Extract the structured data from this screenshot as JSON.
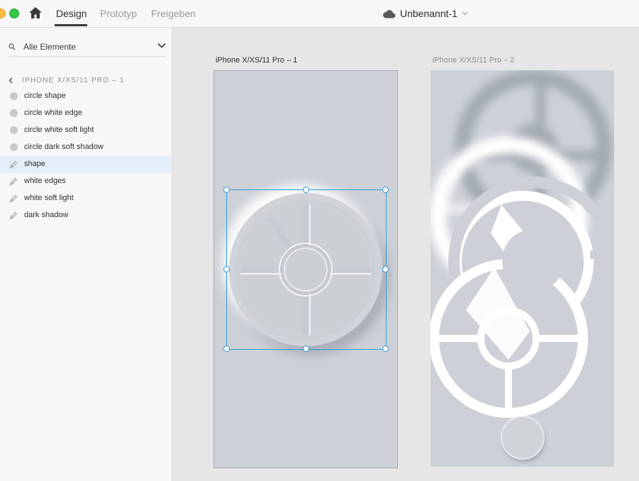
{
  "toolbar": {
    "tabs": [
      "Design",
      "Prototyp",
      "Freigeben"
    ],
    "active_tab": "Design",
    "doc_title": "Unbenannt-1",
    "icons": {
      "home": "home-icon",
      "cloud": "cloud-icon",
      "title_chevron": "chevron-down-icon"
    }
  },
  "sidebar": {
    "search_label": "Alle Elemente",
    "breadcrumb": "IPHONE X/XS/11 PRO – 1",
    "layers": [
      {
        "label": "circle shape",
        "icon": "ellipse-icon",
        "selected": false
      },
      {
        "label": "circle white edge",
        "icon": "ellipse-icon",
        "selected": false
      },
      {
        "label": "circle white soft light",
        "icon": "ellipse-icon",
        "selected": false
      },
      {
        "label": "circle dark soft shadow",
        "icon": "ellipse-icon",
        "selected": false
      },
      {
        "label": "shape",
        "icon": "pen-path-icon",
        "selected": true
      },
      {
        "label": "white edges",
        "icon": "pen-path-icon",
        "selected": false
      },
      {
        "label": "white soft light",
        "icon": "pen-path-icon",
        "selected": false
      },
      {
        "label": "dark shadow",
        "icon": "pen-path-icon",
        "selected": false
      }
    ]
  },
  "canvas": {
    "artboards": [
      {
        "label": "iPhone X/XS/11 Pro – 1",
        "selected": true
      },
      {
        "label": "iPhone X/XS/11 Pro – 2",
        "selected": false
      }
    ]
  },
  "colors": {
    "accent": "#2f9bd8",
    "artboard_bg": "#cdd1d7",
    "selection_bg": "#e3eef8"
  }
}
